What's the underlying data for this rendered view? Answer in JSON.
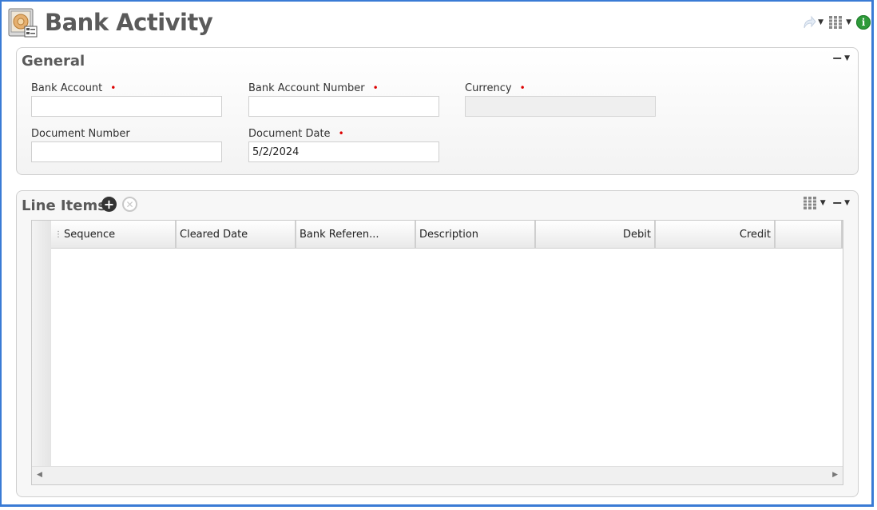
{
  "page": {
    "title": "Bank Activity"
  },
  "general": {
    "title": "General",
    "fields": {
      "bank_account": {
        "label": "Bank Account",
        "required": "•",
        "value": ""
      },
      "bank_account_number": {
        "label": "Bank Account Number",
        "required": "•",
        "value": ""
      },
      "currency": {
        "label": "Currency",
        "required": "•",
        "value": ""
      },
      "document_number": {
        "label": "Document Number",
        "value": ""
      },
      "document_date": {
        "label": "Document Date",
        "required": "•",
        "value": "5/2/2024"
      }
    }
  },
  "line_items": {
    "title": "Line Items",
    "columns": [
      "Sequence",
      "Cleared Date",
      "Bank Referen...",
      "Description",
      "Debit",
      "Credit"
    ],
    "rows": []
  },
  "colors": {
    "frame_border": "#3a7bd5",
    "title_text": "#5a5a5a",
    "required_marker": "#dd0000",
    "info_icon": "#2e9a3a"
  },
  "icons": {
    "app": "bank-vault-icon",
    "share": "share-arrow-icon",
    "columns": "columns-grid-icon",
    "info": "info-icon",
    "add": "add-circle-icon",
    "remove": "remove-circle-icon",
    "collapse": "collapse-minus-icon"
  }
}
